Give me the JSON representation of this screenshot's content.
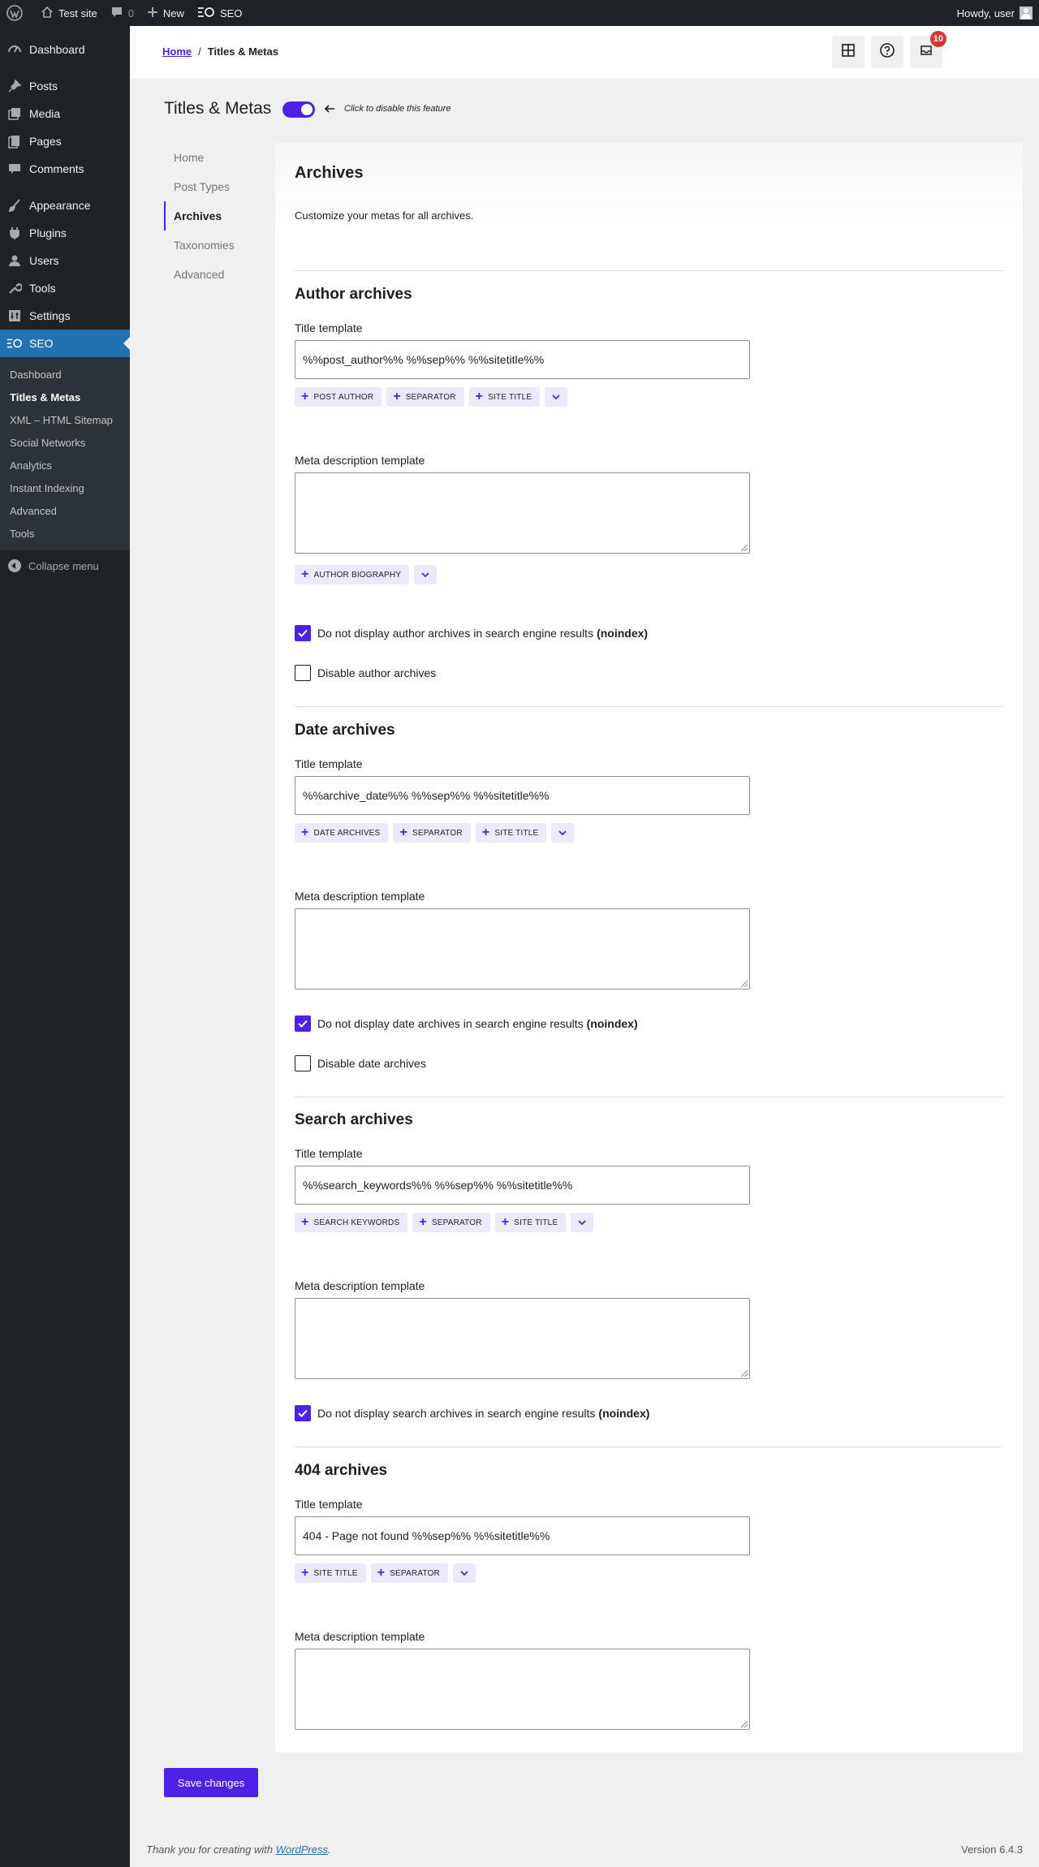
{
  "adminbar": {
    "site_name": "Test site",
    "comments_count": "0",
    "new_label": "New",
    "seo_label": "SEO",
    "greeting": "Howdy, user"
  },
  "sidebar": {
    "items": [
      {
        "label": "Dashboard",
        "icon": "dashboard-icon"
      },
      {
        "label": "Posts",
        "icon": "pin-icon"
      },
      {
        "label": "Media",
        "icon": "media-icon"
      },
      {
        "label": "Pages",
        "icon": "pages-icon"
      },
      {
        "label": "Comments",
        "icon": "comment-icon"
      },
      {
        "label": "Appearance",
        "icon": "brush-icon"
      },
      {
        "label": "Plugins",
        "icon": "plugin-icon"
      },
      {
        "label": "Users",
        "icon": "user-icon"
      },
      {
        "label": "Tools",
        "icon": "wrench-icon"
      },
      {
        "label": "Settings",
        "icon": "settings-icon"
      },
      {
        "label": "SEO",
        "icon": "seo-icon"
      }
    ],
    "submenu": [
      "Dashboard",
      "Titles & Metas",
      "XML – HTML Sitemap",
      "Social Networks",
      "Analytics",
      "Instant Indexing",
      "Advanced",
      "Tools"
    ],
    "collapse_label": "Collapse menu"
  },
  "header": {
    "breadcrumb_home": "Home",
    "breadcrumb_sep": "/",
    "breadcrumb_current": "Titles & Metas",
    "notifications_count": "10"
  },
  "page": {
    "title": "Titles & Metas",
    "toggle_hint": "Click to disable this feature",
    "tabs": [
      "Home",
      "Post Types",
      "Archives",
      "Taxonomies",
      "Advanced"
    ]
  },
  "archives": {
    "heading": "Archives",
    "intro": "Customize your metas for all archives.",
    "title_label": "Title template",
    "meta_label": "Meta description template",
    "author": {
      "heading": "Author archives",
      "title_value": "%%post_author%% %%sep%% %%sitetitle%%",
      "title_tags": [
        "POST AUTHOR",
        "SEPARATOR",
        "SITE TITLE"
      ],
      "meta_tags": [
        "AUTHOR BIOGRAPHY"
      ],
      "noindex_label": "Do not display author archives in search engine results",
      "noindex_bold": "(noindex)",
      "noindex_checked": true,
      "disable_label": "Disable author archives",
      "disable_checked": false
    },
    "date": {
      "heading": "Date archives",
      "title_value": "%%archive_date%% %%sep%% %%sitetitle%%",
      "title_tags": [
        "DATE ARCHIVES",
        "SEPARATOR",
        "SITE TITLE"
      ],
      "noindex_label": "Do not display date archives in search engine results",
      "noindex_bold": "(noindex)",
      "noindex_checked": true,
      "disable_label": "Disable date archives",
      "disable_checked": false
    },
    "search": {
      "heading": "Search archives",
      "title_value": "%%search_keywords%% %%sep%% %%sitetitle%%",
      "title_tags": [
        "SEARCH KEYWORDS",
        "SEPARATOR",
        "SITE TITLE"
      ],
      "noindex_label": "Do not display search archives in search engine results",
      "noindex_bold": "(noindex)",
      "noindex_checked": true
    },
    "notfound": {
      "heading": "404 archives",
      "title_value": "404 - Page not found %%sep%% %%sitetitle%%",
      "title_tags": [
        "SITE TITLE",
        "SEPARATOR"
      ]
    }
  },
  "save_label": "Save changes",
  "footer": {
    "thanks_prefix": "Thank you for creating with",
    "wordpress_link": "WordPress",
    "thanks_suffix": ".",
    "version": "Version 6.4.3"
  },
  "colors": {
    "accent": "#4e21e7",
    "admin_dark": "#1d2327",
    "wp_blue": "#2271b1",
    "badge_red": "#d63638"
  }
}
